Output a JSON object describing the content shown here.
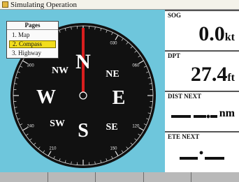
{
  "window": {
    "title": "Simulating Operation",
    "icon": "app-icon"
  },
  "pages_menu": {
    "header": "Pages",
    "items": [
      {
        "label": "1. Map",
        "selected": false
      },
      {
        "label": "2. Compass",
        "selected": true
      },
      {
        "label": "3. Highway",
        "selected": false
      }
    ]
  },
  "compass": {
    "labels": {
      "N": "N",
      "NE": "NE",
      "E": "E",
      "SE": "SE",
      "S": "S",
      "SW": "SW",
      "W": "W",
      "NW": "NW"
    },
    "degree_labels": [
      "030",
      "060",
      "120",
      "150",
      "210",
      "240",
      "300",
      "330"
    ],
    "pointer_heading_deg": 0,
    "pointer_color": "#d81e1e",
    "dial_color": "#111111"
  },
  "fields": {
    "sog": {
      "label": "SOG",
      "value": "0.0",
      "unit": "kt"
    },
    "dpt": {
      "label": "DPT",
      "value": "27.4",
      "unit": "ft"
    },
    "dist_next": {
      "label": "DIST NEXT",
      "value": "—",
      "unit": "nm"
    },
    "ete_next": {
      "label": "ETE NEXT",
      "value": "—"
    }
  },
  "softkeys": [
    "",
    "",
    "",
    "",
    ""
  ]
}
